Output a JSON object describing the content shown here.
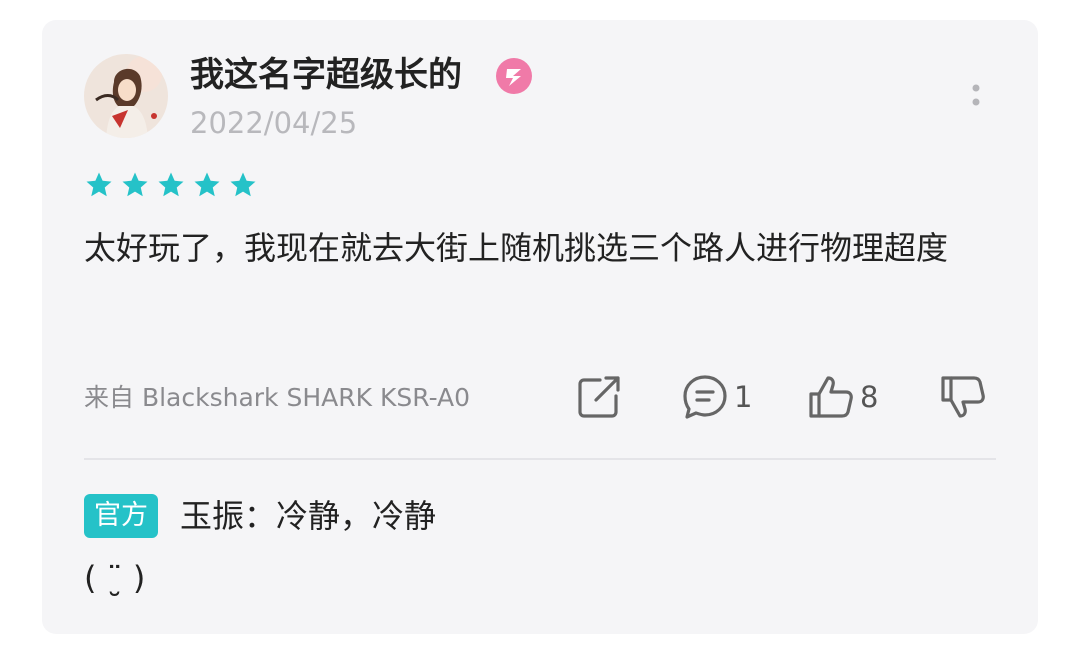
{
  "user": {
    "name": "我这名字超级长的",
    "date": "2022/04/25",
    "badge_icon": "shark-level-badge-icon",
    "avatar": "avatar-illustration"
  },
  "rating": {
    "stars": 5,
    "max": 5,
    "color": "#25c2c8"
  },
  "review": {
    "text": "太好玩了，我现在就去大街上随机挑选三个路人进行物理超度"
  },
  "meta": {
    "device": "来自 Blackshark SHARK KSR-A0"
  },
  "actions": {
    "share_icon": "share-icon",
    "comment_icon": "comment-icon",
    "comment_count": "1",
    "like_icon": "thumbs-up-icon",
    "like_count": "8",
    "dislike_icon": "thumbs-down-icon"
  },
  "reply": {
    "tag": "官方",
    "author": "玉振",
    "separator": "：",
    "text": "冷静，冷静",
    "emoticon": "( ¨̮ )"
  },
  "colors": {
    "accent": "#25c2c8",
    "badge": "#f07aa8",
    "card_bg": "#f5f5f7"
  }
}
